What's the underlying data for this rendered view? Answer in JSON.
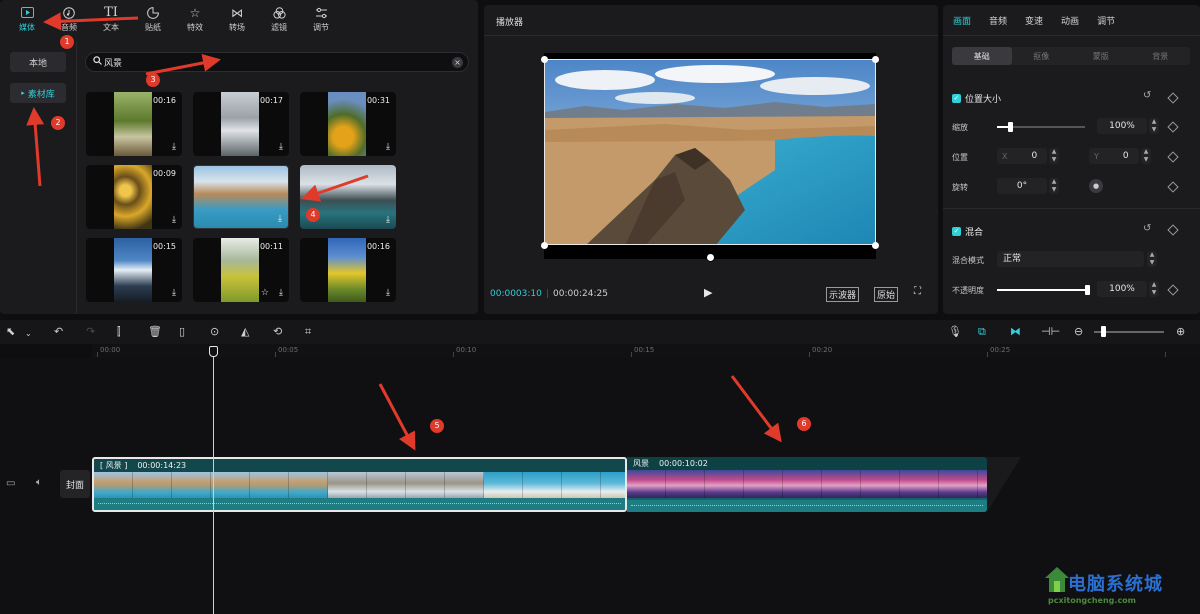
{
  "top_tabs": [
    {
      "label": "媒体",
      "icon": "media-icon"
    },
    {
      "label": "音频",
      "icon": "audio-icon"
    },
    {
      "label": "文本",
      "icon": "text-icon"
    },
    {
      "label": "贴纸",
      "icon": "sticker-icon"
    },
    {
      "label": "特效",
      "icon": "effects-icon"
    },
    {
      "label": "转场",
      "icon": "transition-icon"
    },
    {
      "label": "滤镜",
      "icon": "filter-icon"
    },
    {
      "label": "调节",
      "icon": "adjust-icon"
    }
  ],
  "media_nav": {
    "local": "本地",
    "library": "素材库"
  },
  "search": {
    "value": "风景"
  },
  "media_items": [
    {
      "duration": "00:16"
    },
    {
      "duration": "00:17"
    },
    {
      "duration": "00:31"
    },
    {
      "duration": "00:09"
    },
    {
      "duration": ""
    },
    {
      "duration": ""
    },
    {
      "duration": "00:15"
    },
    {
      "duration": "00:11"
    },
    {
      "duration": "00:16"
    }
  ],
  "player": {
    "title": "播放器",
    "current_time": "00:0003:10",
    "total_time": "00:00:24:25",
    "scope_label": "示波器",
    "original_label": "原始"
  },
  "props": {
    "tabs": [
      "画面",
      "音频",
      "变速",
      "动画",
      "调节"
    ],
    "subtabs": [
      "基础",
      "抠像",
      "蒙版",
      "背景"
    ],
    "position_size": {
      "title": "位置大小",
      "scale_label": "缩放",
      "scale_value": "100%",
      "scale_level": 0.15,
      "position_label": "位置",
      "x_label": "X",
      "x_value": "0",
      "y_label": "Y",
      "y_value": "0",
      "rotate_label": "旋转",
      "rotate_value": "0°"
    },
    "blend": {
      "title": "混合",
      "mode_label": "混合模式",
      "mode_value": "正常",
      "opacity_label": "不透明度",
      "opacity_value": "100%",
      "opacity_level": 1.0
    }
  },
  "timeline": {
    "ruler": [
      "00:00",
      "00:05",
      "00:10",
      "00:15",
      "00:20",
      "00:25"
    ],
    "cover_label": "封面",
    "clip_a": {
      "name": "[ 风景 ]",
      "duration": "00:00:14:23"
    },
    "clip_b": {
      "name": "风景",
      "duration": "00:00:10:02"
    }
  },
  "annotations": [
    "1",
    "2",
    "3",
    "4",
    "5",
    "6"
  ],
  "watermark": {
    "title": "电脑系统城",
    "subtitle": "pcxitongcheng.com"
  },
  "colors": {
    "accent": "#2fd0d7",
    "annotation": "#e03a2a",
    "panel": "#1b1b1e",
    "background": "#0e0e10"
  }
}
